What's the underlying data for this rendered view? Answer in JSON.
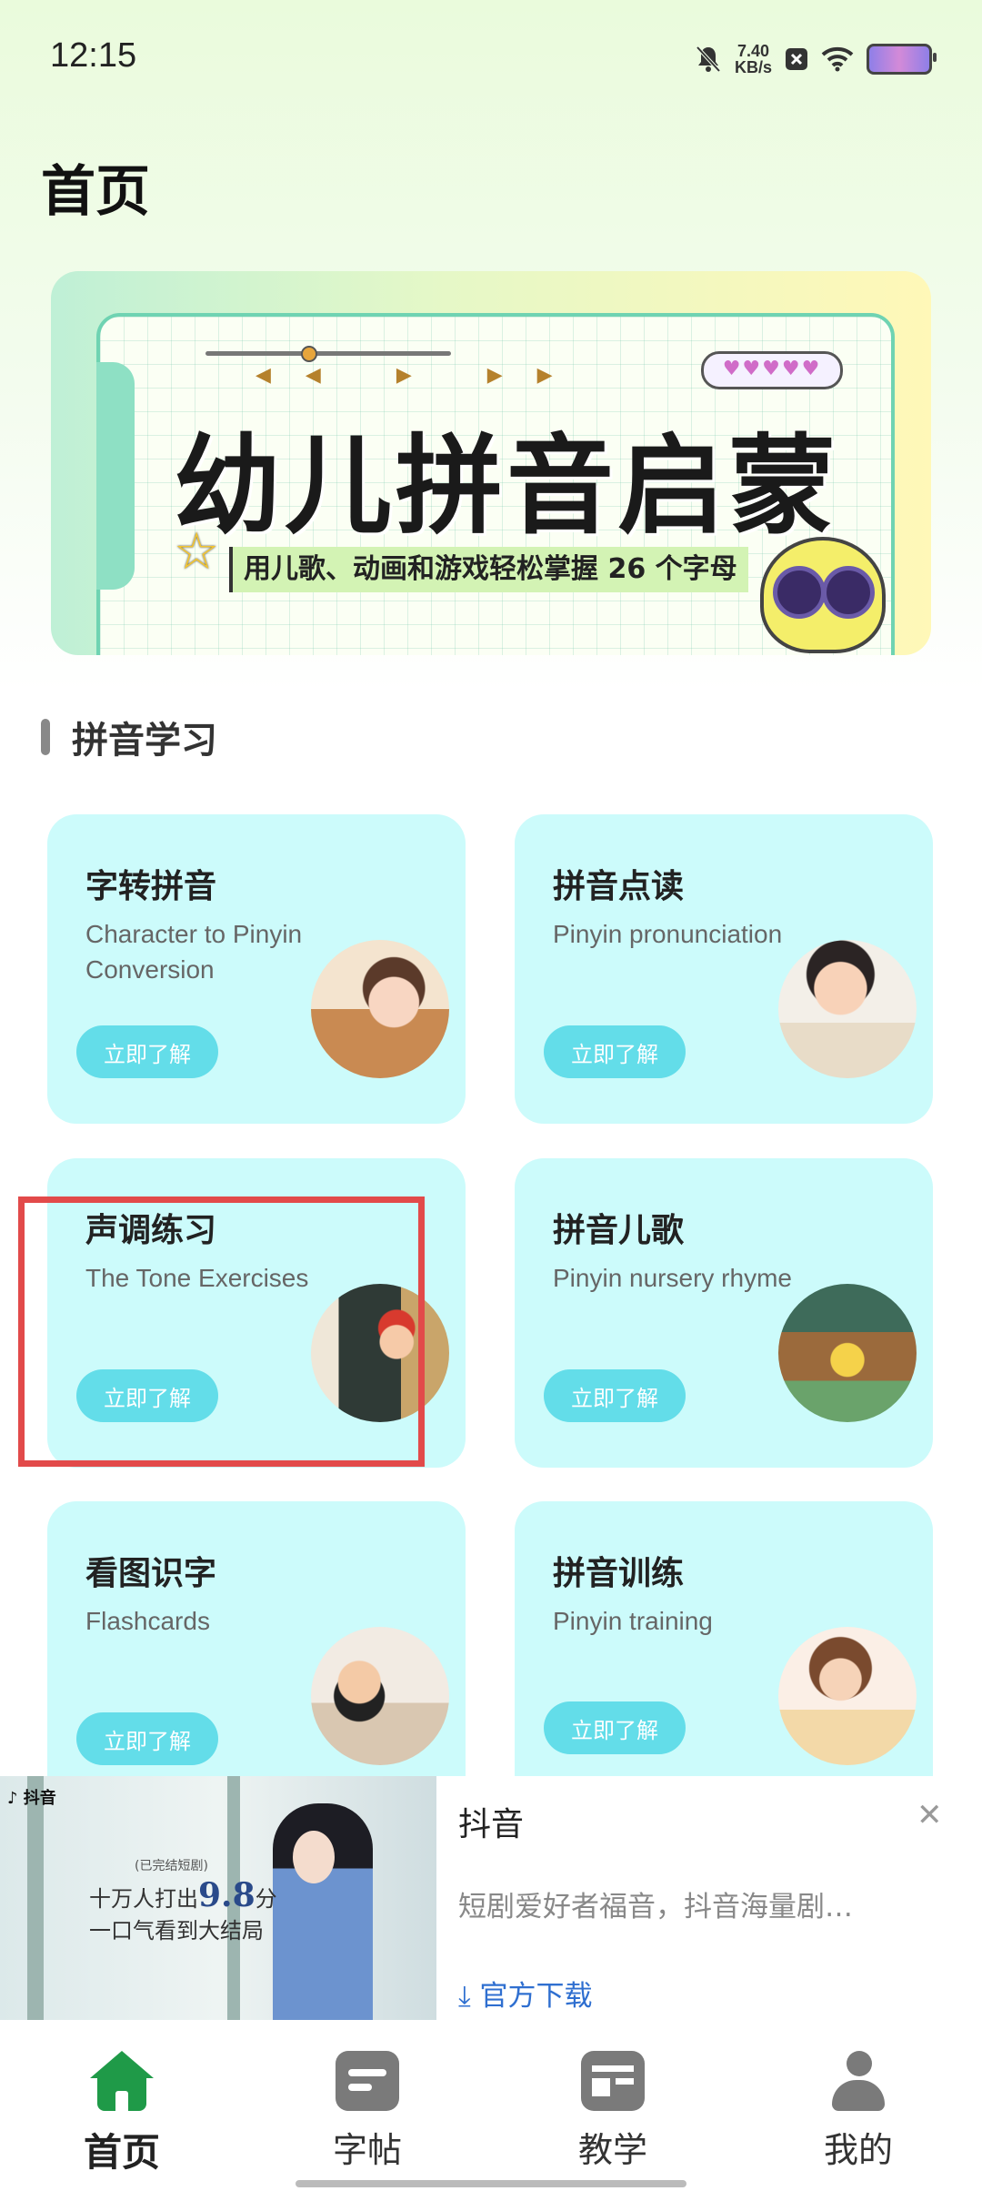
{
  "status_bar": {
    "time": "12:15",
    "net_speed_value": "7.40",
    "net_speed_unit": "KB/s",
    "icons": [
      "bell-off-icon",
      "close-box-icon",
      "wifi-icon",
      "battery-icon"
    ]
  },
  "page_title": "首页",
  "banner": {
    "headline": "幼儿拼音启蒙",
    "subline": "用儿歌、动画和游戏轻松掌握 26 个字母",
    "controls": "◀◀ ▶ ▶▶",
    "hearts": "♥♥♥♥♥"
  },
  "section": {
    "title": "拼音学习"
  },
  "cards": [
    {
      "title": "字转拼音",
      "subtitle": "Character to Pinyin Conversion",
      "button": "立即了解"
    },
    {
      "title": "拼音点读",
      "subtitle": "Pinyin pronunciation",
      "button": "立即了解"
    },
    {
      "title": "声调练习",
      "subtitle": "The Tone Exercises",
      "button": "立即了解"
    },
    {
      "title": "拼音儿歌",
      "subtitle": "Pinyin nursery rhyme",
      "button": "立即了解"
    },
    {
      "title": "看图识字",
      "subtitle": "Flashcards",
      "button": "立即了解"
    },
    {
      "title": "拼音训练",
      "subtitle": "Pinyin training",
      "button": "立即了解"
    }
  ],
  "ad": {
    "image_logo": "抖音",
    "image_small": "(已完结短剧)",
    "image_line1_pre": "十万人打出",
    "image_score": "9.8",
    "image_line1_post": "分",
    "image_line2": "一口气看到大结局",
    "title": "抖音",
    "description": "短剧爱好者福音，抖音海量剧…",
    "download": "⤓ 官方下载",
    "close": "✕"
  },
  "nav": {
    "items": [
      {
        "label": "首页",
        "icon": "home-icon",
        "active": true
      },
      {
        "label": "字帖",
        "icon": "copybook-icon",
        "active": false
      },
      {
        "label": "教学",
        "icon": "teaching-icon",
        "active": false
      },
      {
        "label": "我的",
        "icon": "profile-icon",
        "active": false
      }
    ]
  },
  "colors": {
    "card_bg": "#ccfbfb",
    "button_bg": "#63dde9",
    "nav_active": "#1f9a48",
    "highlight_box": "#e24a4a",
    "download_link": "#2f6fd0"
  }
}
